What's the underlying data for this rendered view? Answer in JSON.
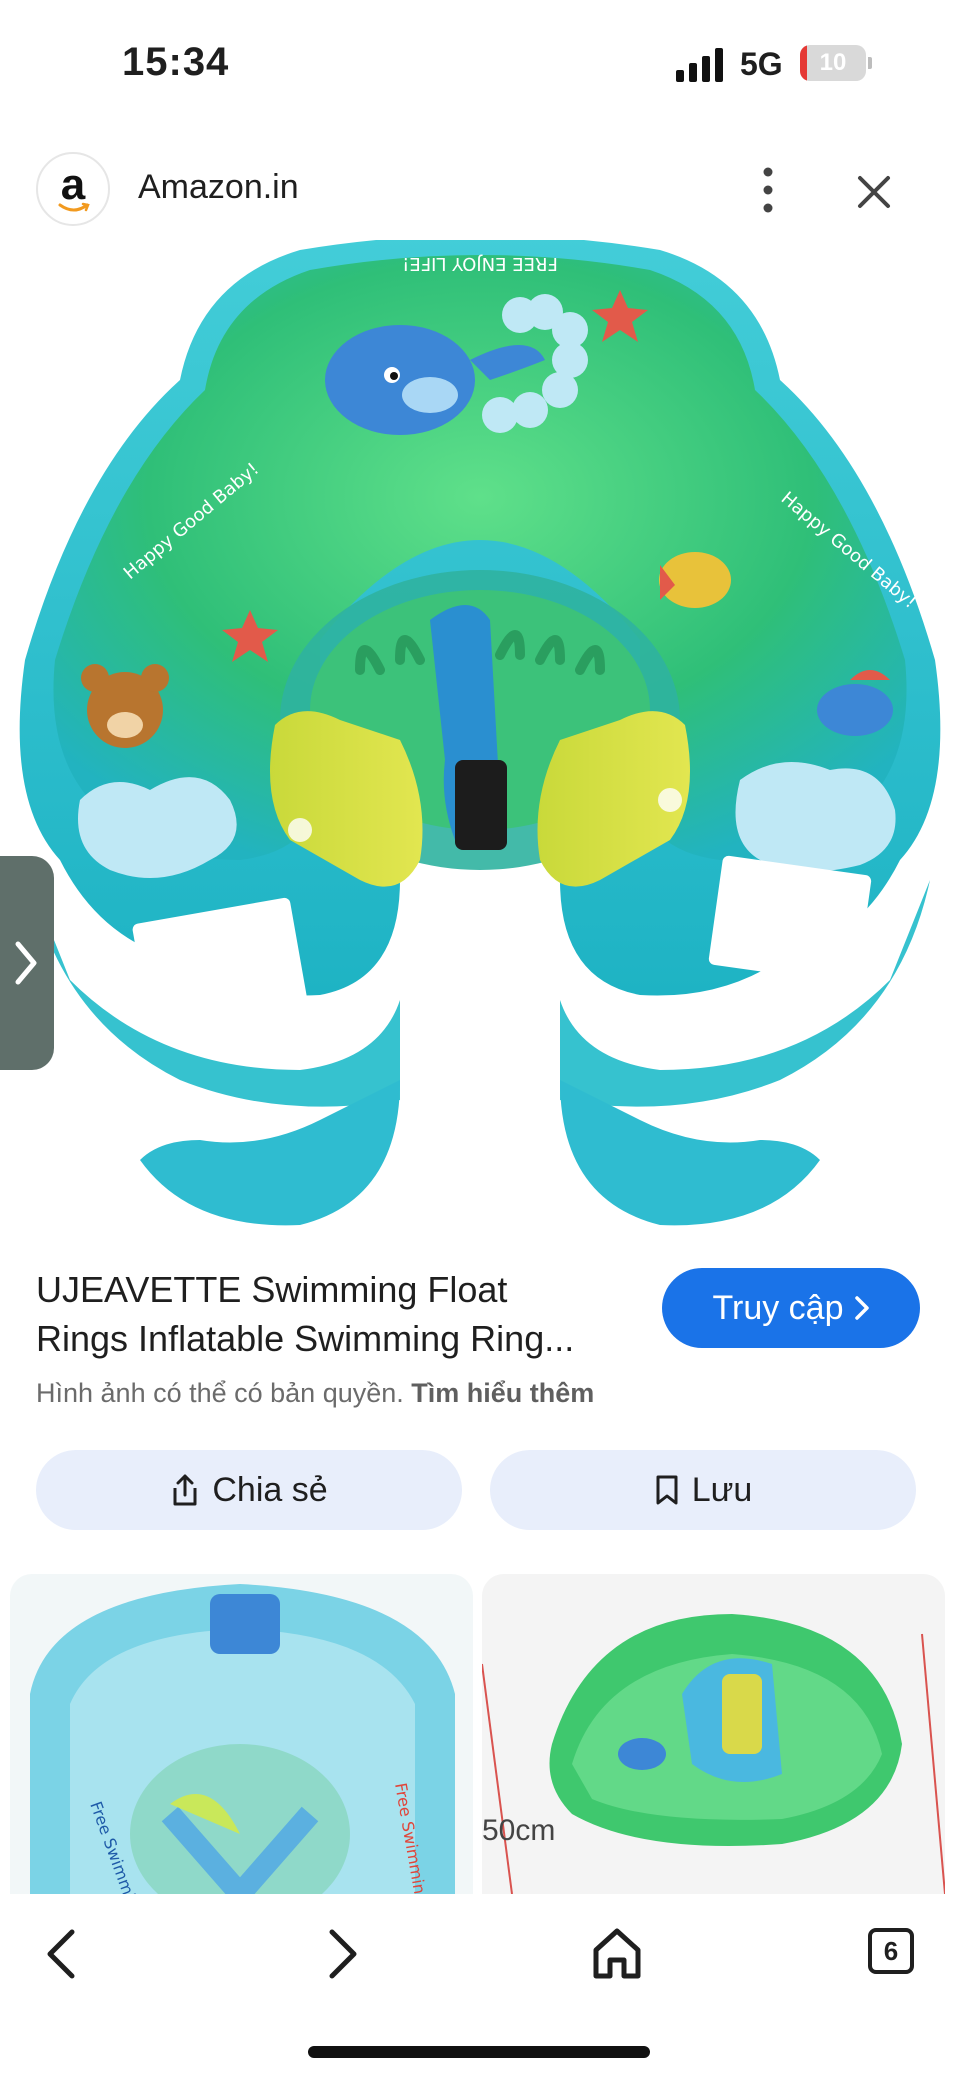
{
  "status_bar": {
    "time": "15:34",
    "network": "5G",
    "battery_level": "10",
    "battery_color": "#e53935"
  },
  "header": {
    "site_logo_letter": "a",
    "site_name": "Amazon.in",
    "more_icon": "vertical-dots-icon",
    "close_icon": "close-icon"
  },
  "product": {
    "image_description_icon": "inflatable-baby-swim-ring-image",
    "title_line1": "UJEAVETTE Swimming Float",
    "title_line2": "Rings Inflatable Swimming Ring...",
    "visit_label": "Truy cập",
    "copyright_text": "Hình ảnh có thể có bản quyền.",
    "learn_more_label": "Tìm hiểu thêm"
  },
  "actions": {
    "share_label": "Chia sẻ",
    "save_label": "Lưu"
  },
  "related": {
    "thumb2_label": "50cm"
  },
  "bottom_nav": {
    "tab_count": "6"
  },
  "colors": {
    "accent": "#1a73e8",
    "chip_bg": "#e8eefb",
    "ring_green": "#3ec96a",
    "ring_teal": "#3cc7cf"
  }
}
